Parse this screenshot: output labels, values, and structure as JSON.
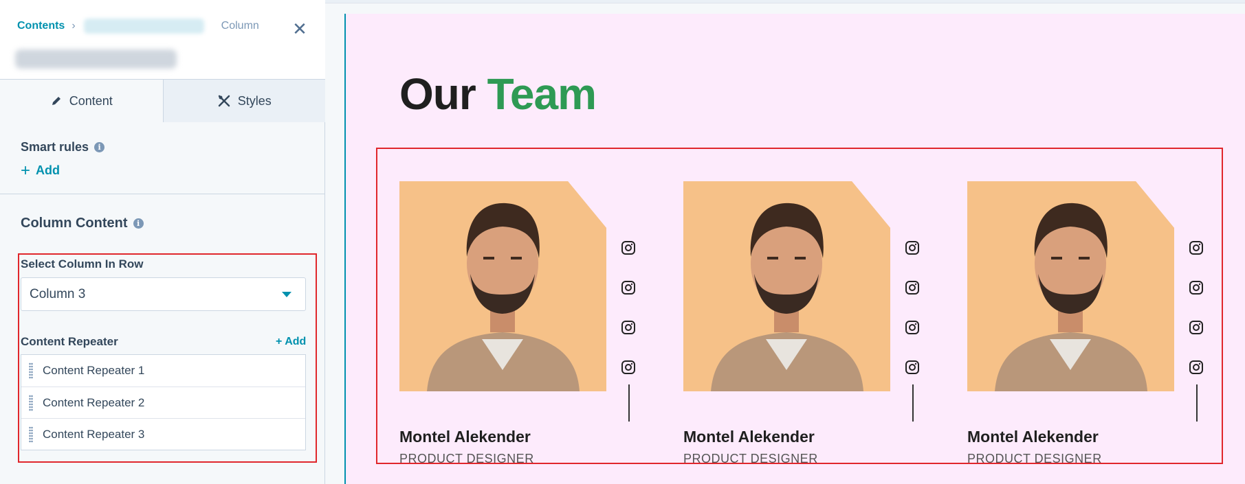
{
  "sidebar": {
    "breadcrumb": {
      "root": "Contents",
      "current": "Column"
    },
    "tabs": [
      {
        "label": "Content"
      },
      {
        "label": "Styles"
      }
    ],
    "smart_rules": {
      "label": "Smart rules",
      "add_label": "Add"
    },
    "column_content": {
      "label": "Column Content",
      "select_label": "Select Column In Row",
      "select_value": "Column 3",
      "repeater_label": "Content Repeater",
      "repeater_add": "+ Add",
      "repeaters": [
        {
          "label": "Content Repeater 1"
        },
        {
          "label": "Content Repeater 2"
        },
        {
          "label": "Content Repeater 3"
        }
      ]
    }
  },
  "preview": {
    "heading_part1": "Our",
    "heading_part2": "Team",
    "cards": [
      {
        "name": "Montel Alekender",
        "role": "PRODUCT DESIGNER"
      },
      {
        "name": "Montel Alekender",
        "role": "PRODUCT DESIGNER"
      },
      {
        "name": "Montel Alekender",
        "role": "PRODUCT DESIGNER"
      }
    ],
    "colors": {
      "accent": "#2e9a54",
      "link": "#0091ae",
      "highlight": "#e0262b",
      "page_bg": "#fdebfc",
      "photo_bg": "#f6c188"
    },
    "social_icon": "instagram-icon"
  }
}
